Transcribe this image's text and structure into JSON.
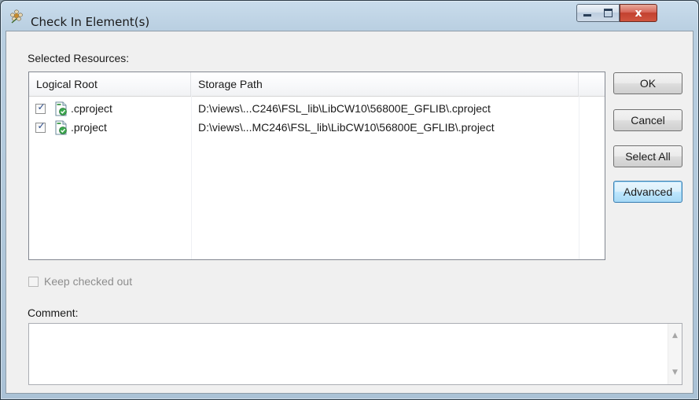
{
  "window": {
    "title": "Check In Element(s)",
    "buttons": {
      "minimize": "minimize",
      "maximize": "maximize",
      "close": "x"
    }
  },
  "resources": {
    "label": "Selected Resources:",
    "columns": [
      "Logical Root",
      "Storage Path"
    ],
    "rows": [
      {
        "checked": true,
        "name": ".cproject",
        "path": "D:\\views\\...C246\\FSL_lib\\LibCW10\\56800E_GFLIB\\.cproject"
      },
      {
        "checked": true,
        "name": ".project",
        "path": "D:\\views\\...MC246\\FSL_lib\\LibCW10\\56800E_GFLIB\\.project"
      }
    ]
  },
  "buttons": {
    "ok": "OK",
    "cancel": "Cancel",
    "select_all": "Select All",
    "advanced": "Advanced"
  },
  "keep_checked_out": {
    "label": "Keep checked out",
    "checked": false,
    "enabled": false
  },
  "comment": {
    "label": "Comment:",
    "value": ""
  },
  "colors": {
    "title_bar": "#b9cfe1",
    "advanced_focus": "#3c7fb1",
    "close_button": "#c2412f"
  },
  "icons": {
    "app": "flower-icon",
    "file": "checked-out-file-icon"
  }
}
